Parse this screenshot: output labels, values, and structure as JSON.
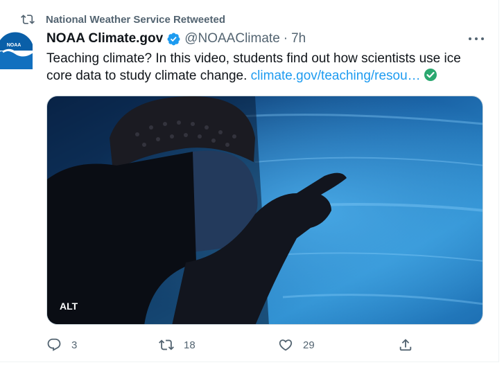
{
  "social_context": {
    "text": "National Weather Service Retweeted",
    "icon": "retweet-icon"
  },
  "author": {
    "name": "NOAA Climate.gov",
    "handle": "@NOAAClimate",
    "separator": "·",
    "time": "7h",
    "avatar_text": "NOAA",
    "verified_icon": "verified-badge-icon",
    "colors": {
      "avatar_blue": "#0a5fa8",
      "verified": "#1d9bf0"
    }
  },
  "tweet": {
    "text": "Teaching climate? In this video, students find out how scientists use ice core data to study climate change. ",
    "link_text": "climate.gov/teaching/resou…",
    "link_icon": "check-circle-icon",
    "link_color": "#1d9bf0"
  },
  "media": {
    "alt_badge": "ALT"
  },
  "actions": {
    "replies": {
      "icon": "reply-icon",
      "count": "3"
    },
    "retweets": {
      "icon": "retweet-icon",
      "count": "18"
    },
    "likes": {
      "icon": "heart-icon",
      "count": "29"
    },
    "share": {
      "icon": "share-icon"
    }
  },
  "more_icon": "more-options-icon"
}
